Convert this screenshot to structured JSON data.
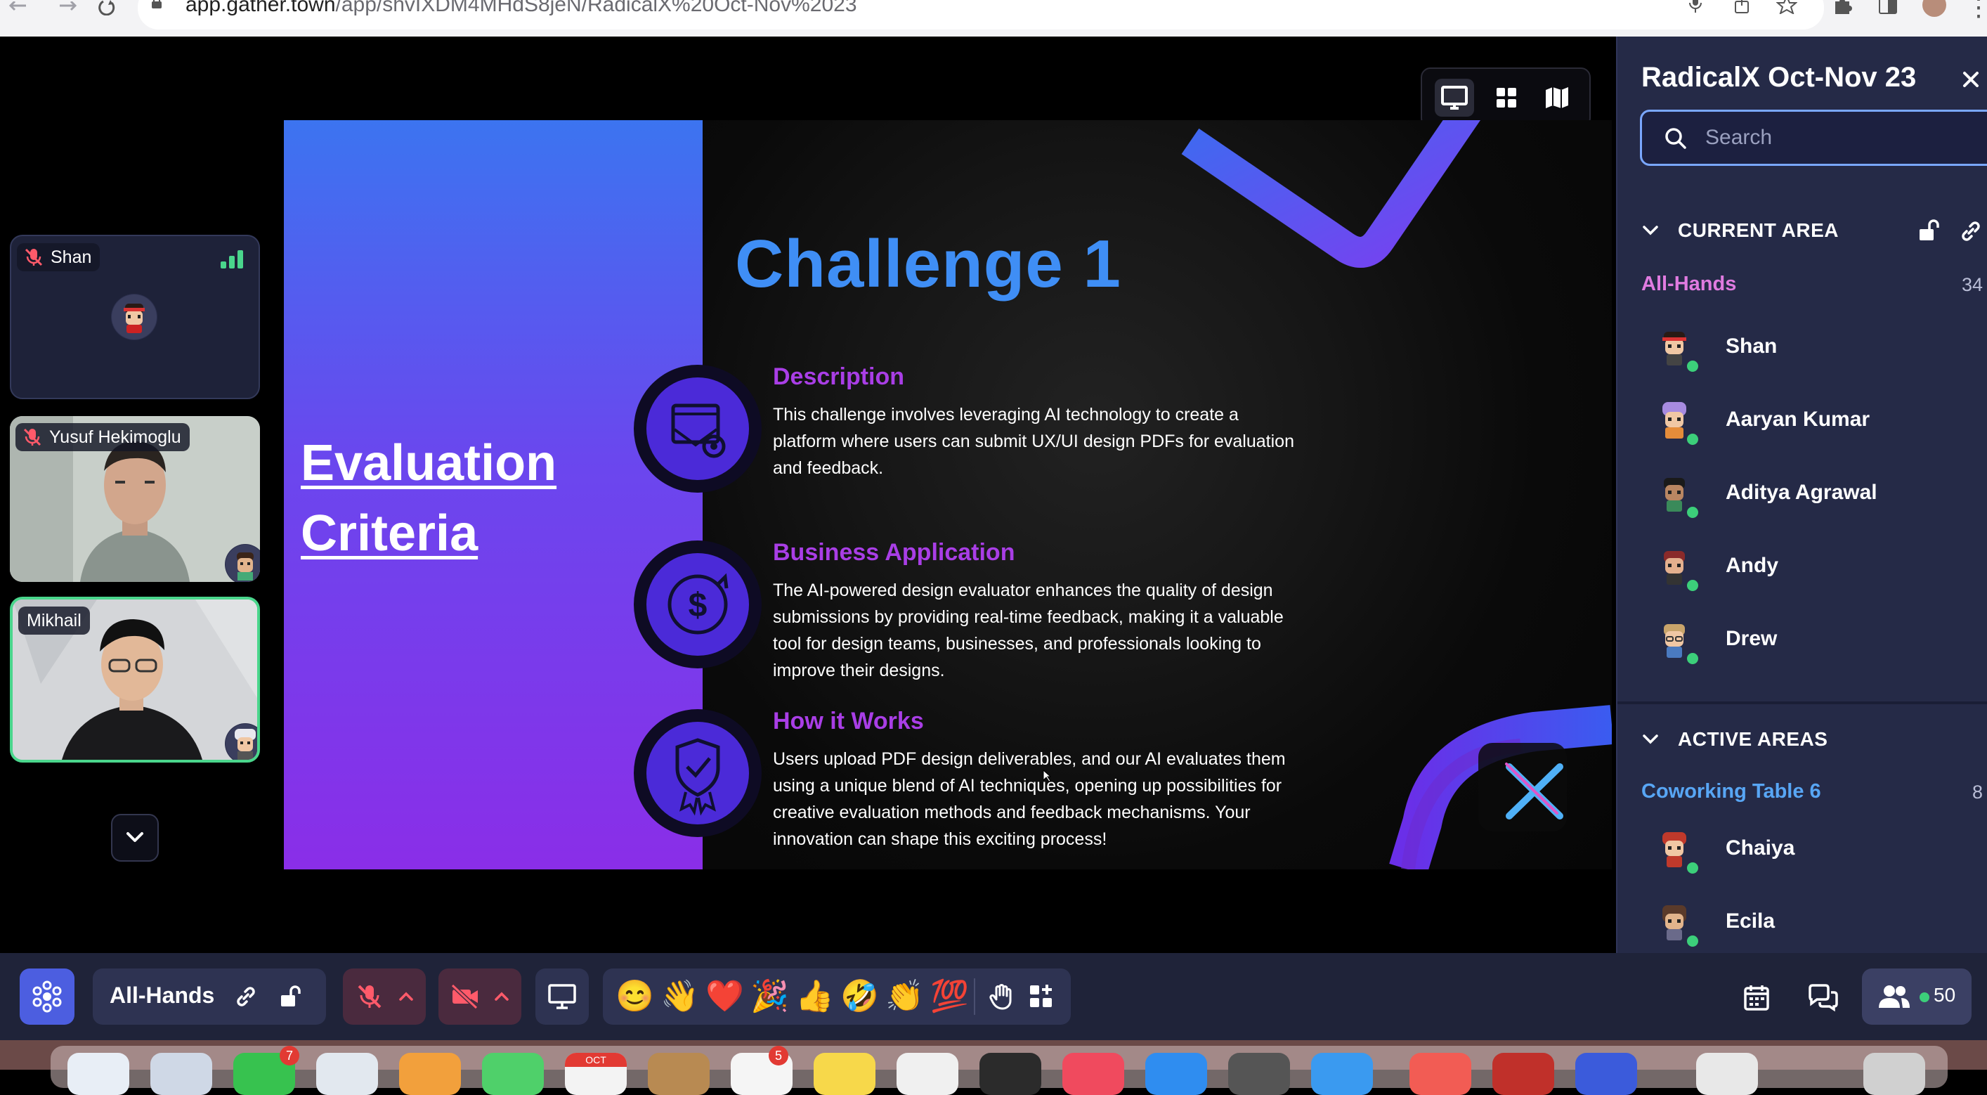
{
  "browser": {
    "url_host": "app.gather.town",
    "url_path": "/app/shvIXDM4MHdS8jeN/RadicalX%20Oct-Nov%2023"
  },
  "participants": [
    {
      "name": "Shan",
      "mic_muted": true
    },
    {
      "name": "Yusuf Hekimoglu",
      "mic_muted": true
    },
    {
      "name": "Mikhail",
      "mic_muted": false
    }
  ],
  "view_modes": [
    "screen",
    "grid",
    "map"
  ],
  "slide": {
    "left_title_line1": "Evaluation",
    "left_title_line2": "Criteria",
    "title": "Challenge 1",
    "sections": [
      {
        "heading": "Description",
        "text": "This challenge involves leveraging AI technology to create a platform where users can submit UX/UI design PDFs for evaluation and feedback."
      },
      {
        "heading": "Business Application",
        "text": "The AI-powered design evaluator enhances the quality of design submissions by providing real-time feedback, making it a valuable tool for design teams, businesses, and professionals looking to improve their designs."
      },
      {
        "heading": "How it Works",
        "text": "Users upload PDF design deliverables, and our AI evaluates them using a unique blend of AI techniques, opening up possibilities for creative evaluation methods and feedback mechanisms. Your innovation can shape this exciting process!"
      }
    ]
  },
  "panel": {
    "title": "RadicalX Oct-Nov 23",
    "search_placeholder": "Search",
    "current_area_label": "CURRENT AREA",
    "current_area": {
      "name": "All-Hands",
      "count": "34"
    },
    "current_members": [
      "Shan",
      "Aaryan Kumar",
      "Aditya Agrawal",
      "Andy",
      "Drew"
    ],
    "active_areas_label": "ACTIVE AREAS",
    "active_area": {
      "name": "Coworking Table 6",
      "count": "8"
    },
    "active_members": [
      "Chaiya",
      "Ecila"
    ]
  },
  "bottombar": {
    "area_name": "All-Hands",
    "emojis": [
      "😊",
      "👋",
      "❤️",
      "🎉",
      "👍",
      "🤣",
      "👏",
      "💯"
    ],
    "people_count": "50"
  },
  "dock": {
    "badges": [
      "7",
      "5"
    ],
    "calendar_month": "OCT"
  },
  "colors": {
    "accent_pink": "#e07be0",
    "accent_blue": "#58a6f5",
    "panel_bg": "#252a47",
    "online": "#3ccf7a",
    "slide_title": "#3f8ef5",
    "slide_heading": "#a93ee6"
  }
}
